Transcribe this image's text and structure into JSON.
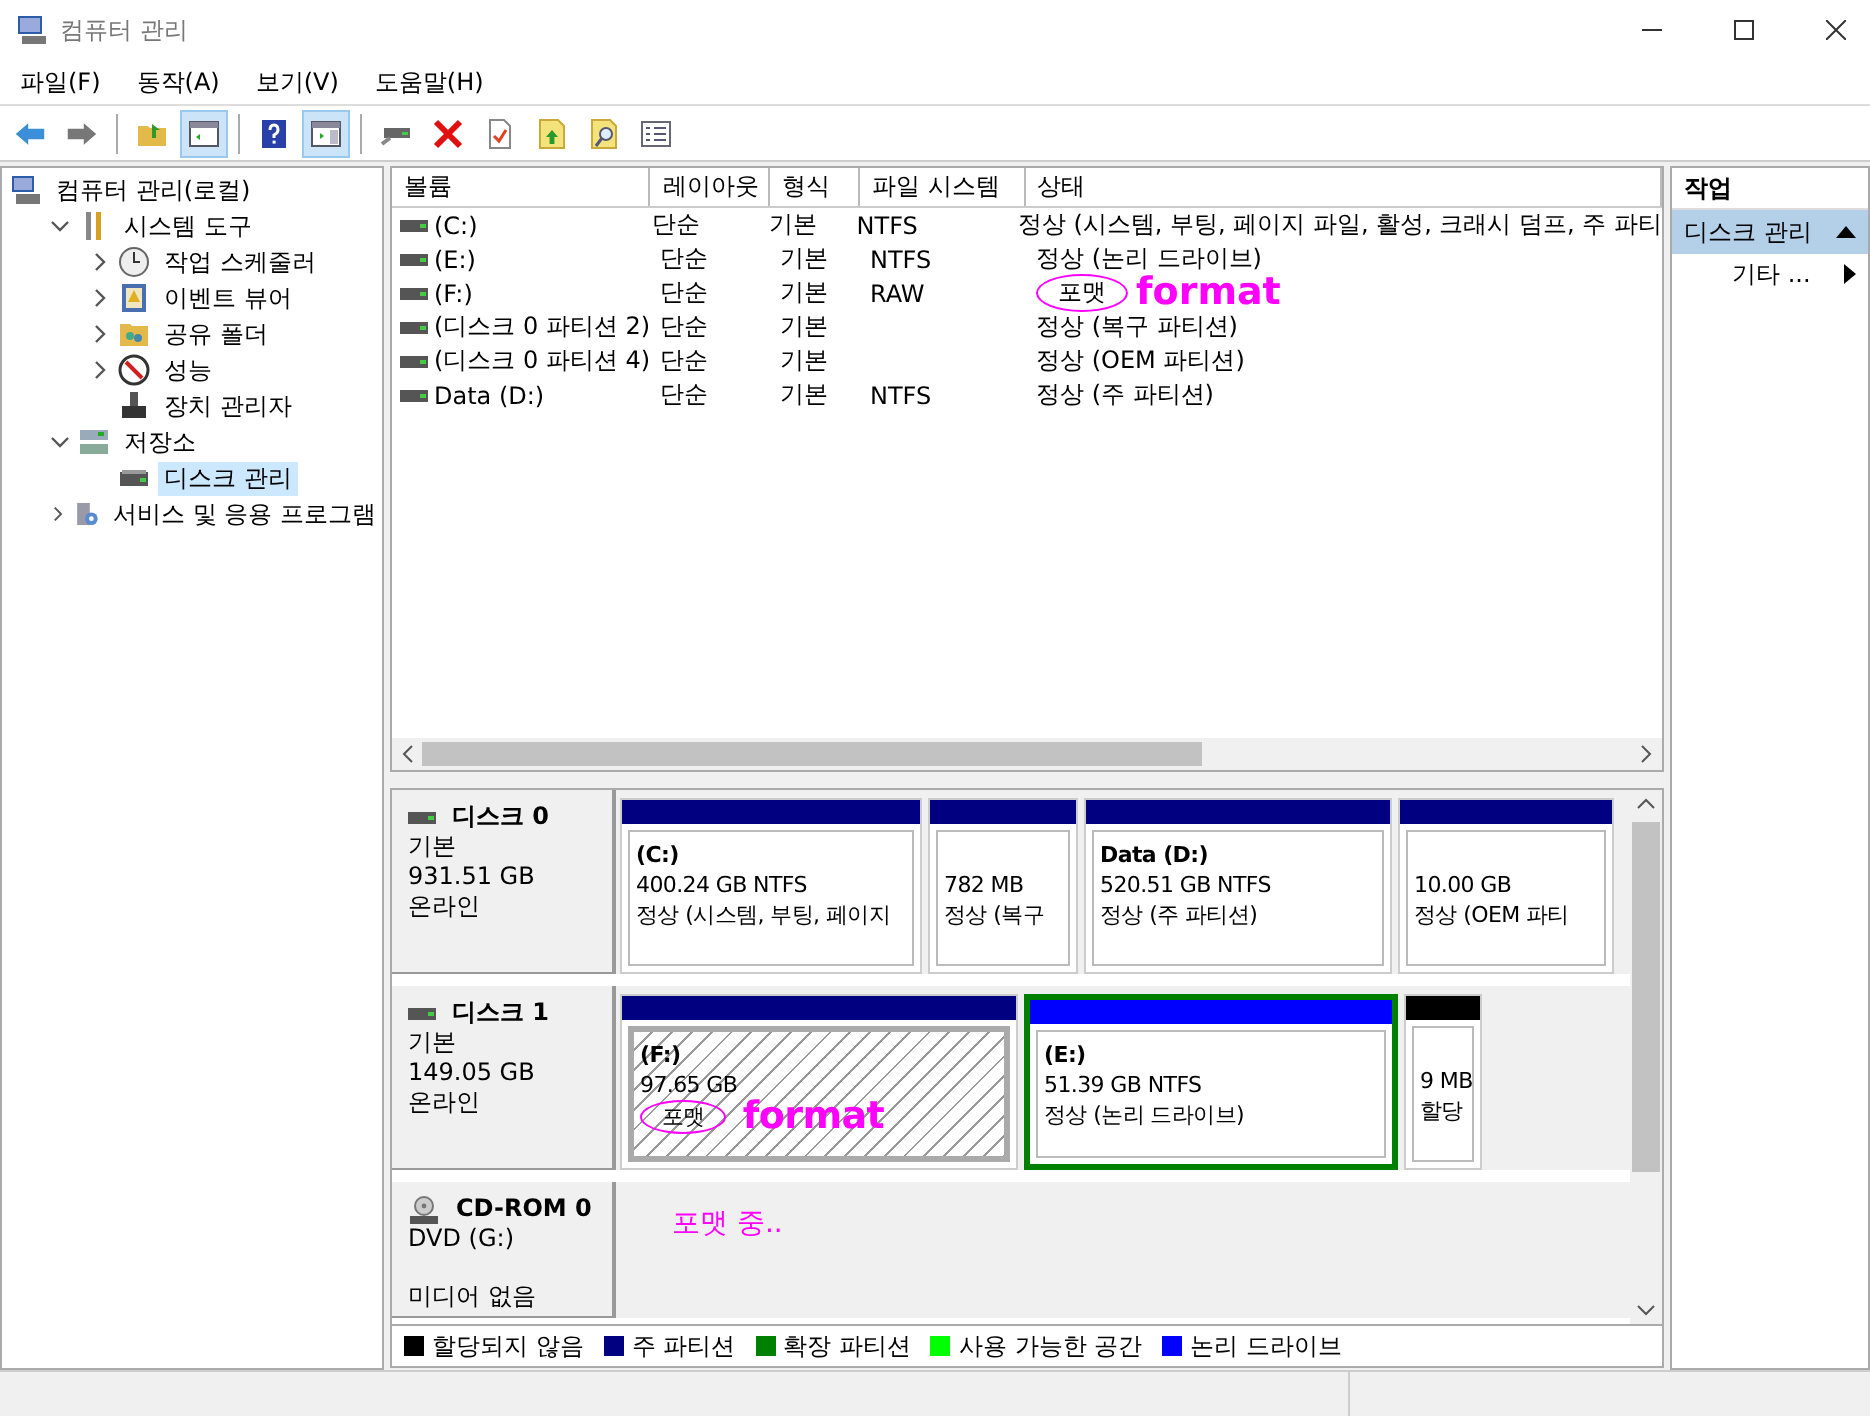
{
  "window": {
    "title": "컴퓨터 관리"
  },
  "menu": [
    "파일(F)",
    "동작(A)",
    "보기(V)",
    "도움말(H)"
  ],
  "toolbar": [
    {
      "kind": "back",
      "selected": false
    },
    {
      "kind": "forward",
      "selected": false
    },
    {
      "kind": "sep"
    },
    {
      "kind": "up",
      "selected": false
    },
    {
      "kind": "tree",
      "selected": true
    },
    {
      "kind": "sep"
    },
    {
      "kind": "help",
      "selected": false
    },
    {
      "kind": "action",
      "selected": true
    },
    {
      "kind": "sep"
    },
    {
      "kind": "connect",
      "selected": false
    },
    {
      "kind": "delete",
      "selected": false
    },
    {
      "kind": "properties",
      "selected": false
    },
    {
      "kind": "export",
      "selected": false
    },
    {
      "kind": "find",
      "selected": false
    },
    {
      "kind": "list",
      "selected": false
    }
  ],
  "tree": [
    {
      "label": "컴퓨터 관리(로컬)",
      "selected": false,
      "children": [
        {
          "label": "시스템 도구",
          "expanded": true,
          "selected": false,
          "children": [
            {
              "label": "작업 스케줄러",
              "expanded": false,
              "selected": false
            },
            {
              "label": "이벤트 뷰어",
              "expanded": false,
              "selected": false
            },
            {
              "label": "공유 폴더",
              "expanded": false,
              "selected": false
            },
            {
              "label": "성능",
              "expanded": false,
              "selected": false
            },
            {
              "label": "장치 관리자",
              "selected": false
            }
          ]
        },
        {
          "label": "저장소",
          "expanded": true,
          "selected": false,
          "children": [
            {
              "label": "디스크 관리",
              "selected": true
            }
          ]
        },
        {
          "label": "서비스 및 응용 프로그램",
          "expanded": false,
          "selected": false
        }
      ]
    }
  ],
  "volumes": {
    "columns": [
      "볼륨",
      "레이아웃",
      "형식",
      "파일 시스템",
      "상태"
    ],
    "rows": [
      {
        "volume": "(C:)",
        "layout": "단순",
        "type": "기본",
        "fs": "NTFS",
        "status": "정상 (시스템, 부팅, 페이지 파일, 활성, 크래시 덤프, 주 파티",
        "circled": false
      },
      {
        "volume": "(E:)",
        "layout": "단순",
        "type": "기본",
        "fs": "NTFS",
        "status": "정상 (논리 드라이브)",
        "circled": false
      },
      {
        "volume": "(F:)",
        "layout": "단순",
        "type": "기본",
        "fs": "RAW",
        "status": "포맷",
        "circled": true,
        "note": "format"
      },
      {
        "volume": "(디스크 0 파티션 2)",
        "layout": "단순",
        "type": "기본",
        "status": "정상 (복구 파티션)",
        "circled": false
      },
      {
        "volume": "(디스크 0 파티션 4)",
        "layout": "단순",
        "type": "기본",
        "status": "정상 (OEM 파티션)",
        "circled": false
      },
      {
        "volume": "Data (D:)",
        "layout": "단순",
        "type": "기본",
        "fs": "NTFS",
        "status": "정상 (주 파티션)",
        "circled": false
      }
    ]
  },
  "disks": [
    {
      "name": "디스크 0",
      "type": "기본",
      "size": "931.51 GB",
      "status": "온라인",
      "partitions": [
        {
          "kind": "primary",
          "label": "(C:)",
          "size": "400.24 GB NTFS",
          "status": "정상 (시스템, 부팅, 페이지",
          "formatting": false,
          "extended": false,
          "circled": false
        },
        {
          "kind": "primary",
          "size": "782 MB",
          "status": "정상 (복구",
          "formatting": false,
          "extended": false,
          "circled": false
        },
        {
          "kind": "primary",
          "label": "Data  (D:)",
          "size": "520.51 GB NTFS",
          "status": "정상 (주 파티션)",
          "formatting": false,
          "extended": false,
          "circled": false
        },
        {
          "kind": "primary",
          "size": "10.00 GB",
          "status": "정상 (OEM 파티",
          "formatting": false,
          "extended": false,
          "circled": false
        }
      ]
    },
    {
      "name": "디스크 1",
      "type": "기본",
      "size": "149.05 GB",
      "status": "온라인",
      "partitions": [
        {
          "kind": "primary",
          "label": "(F:)",
          "size": "97.65 GB",
          "status": "포맷",
          "formatting": true,
          "extended": false,
          "circled": true,
          "note": "format"
        },
        {
          "kind": "logical",
          "label": "(E:)",
          "size": "51.39 GB NTFS",
          "status": "정상 (논리 드라이브)",
          "formatting": false,
          "extended": true,
          "circled": false
        },
        {
          "kind": "unallocated",
          "size": "9 MB",
          "status": "할당",
          "formatting": false,
          "extended": false,
          "circled": false
        }
      ]
    }
  ],
  "cdrom": {
    "name": "CD-ROM 0",
    "drive": "DVD (G:)",
    "status": "미디어 없음",
    "note": "포맷 중.."
  },
  "legend": [
    {
      "label": "할당되지 않음",
      "color": "#000000"
    },
    {
      "label": "주 파티션",
      "color": "#000080"
    },
    {
      "label": "확장 파티션",
      "color": "#008000"
    },
    {
      "label": "사용 가능한 공간",
      "color": "#00ff00"
    },
    {
      "label": "논리 드라이브",
      "color": "#0000ff"
    }
  ],
  "actions": {
    "heading": "작업",
    "sections": [
      {
        "label": "디스크 관리",
        "expanded": true,
        "items": [
          "기타 ..."
        ]
      }
    ]
  }
}
